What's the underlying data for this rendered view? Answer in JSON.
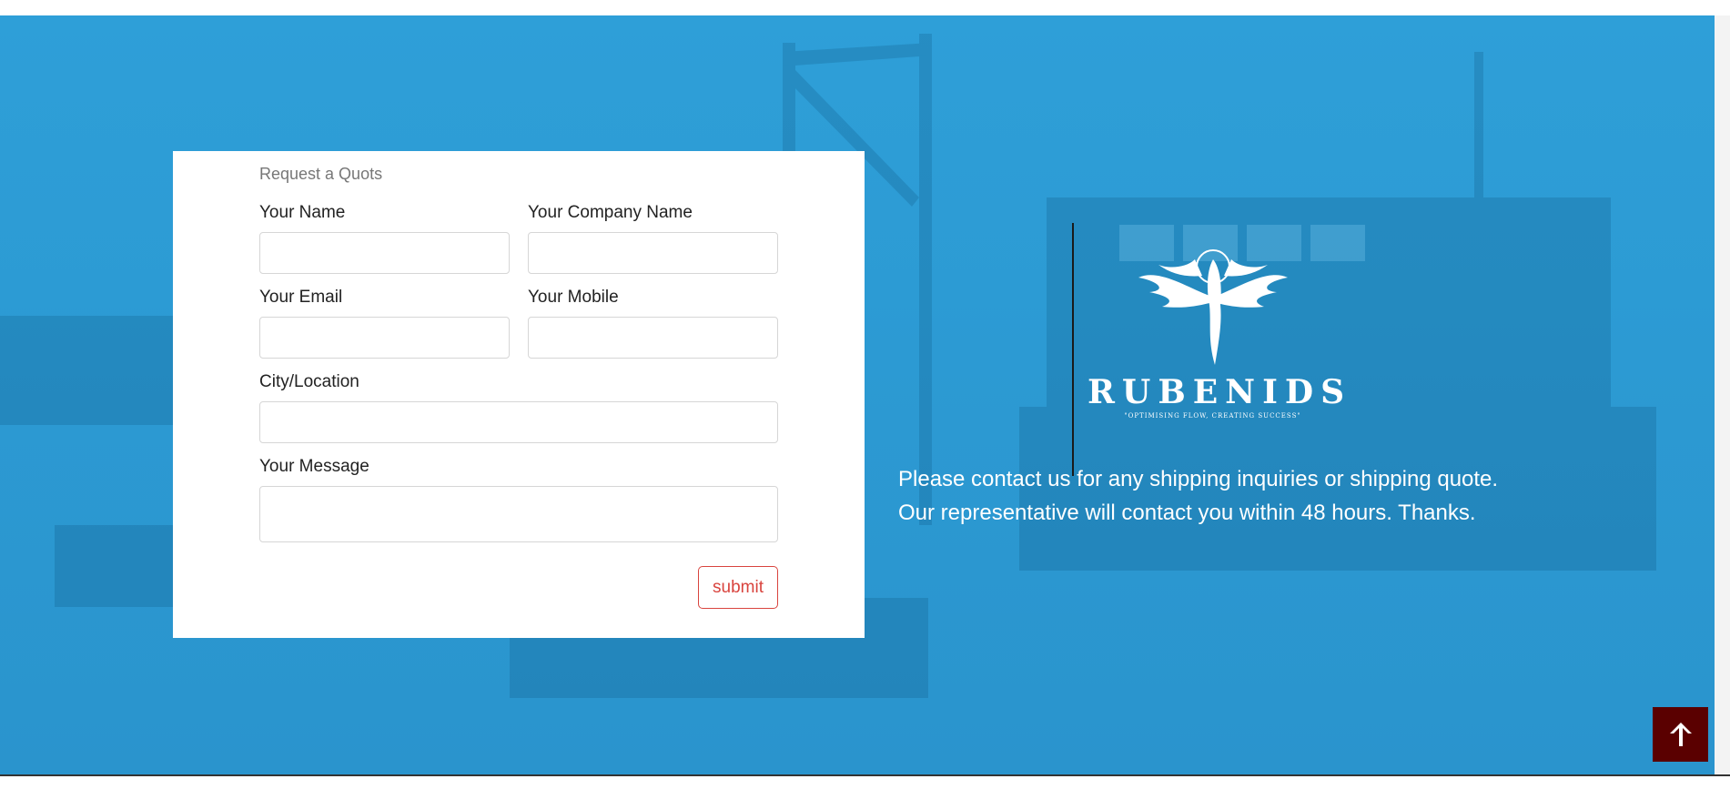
{
  "form": {
    "heading": "Request a Quots",
    "fields": {
      "name": {
        "label": "Your Name",
        "value": "",
        "placeholder": ""
      },
      "company": {
        "label": "Your Company Name",
        "value": "",
        "placeholder": ""
      },
      "email": {
        "label": "Your Email",
        "value": "",
        "placeholder": ""
      },
      "mobile": {
        "label": "Your Mobile",
        "value": "",
        "placeholder": ""
      },
      "city": {
        "label": "City/Location",
        "value": "",
        "placeholder": ""
      },
      "message": {
        "label": "Your Message",
        "value": "",
        "placeholder": ""
      }
    },
    "submit_label": "submit"
  },
  "brand": {
    "name": "RUBENIDS",
    "tagline": "\"OPTIMISING FLOW, CREATING SUCCESS\"",
    "emblem_icon": "winged-phoenix-icon"
  },
  "contact": {
    "text": "Please contact us for any shipping inquiries or shipping quote. Our representative will contact you within 48 hours. Thanks."
  },
  "scroll_top": {
    "icon": "arrow-up-icon"
  },
  "colors": {
    "hero_blue": "#2e9fd8",
    "submit_red": "#d9443e",
    "scroll_button_bg": "#5a0000",
    "card_bg": "#ffffff"
  }
}
